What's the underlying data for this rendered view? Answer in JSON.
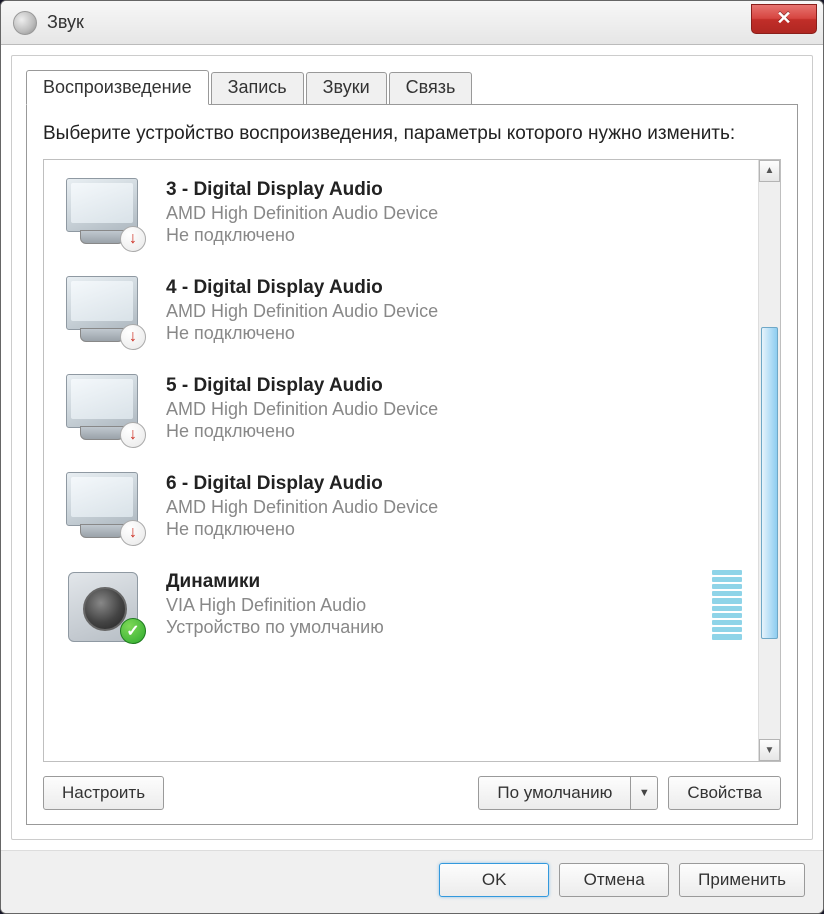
{
  "window": {
    "title": "Звук"
  },
  "tabs": [
    {
      "label": "Воспроизведение",
      "active": true
    },
    {
      "label": "Запись",
      "active": false
    },
    {
      "label": "Звуки",
      "active": false
    },
    {
      "label": "Связь",
      "active": false
    }
  ],
  "instruction": "Выберите устройство воспроизведения, параметры которого нужно изменить:",
  "devices": [
    {
      "name": "3 - Digital Display Audio",
      "description": "AMD High Definition Audio Device",
      "status": "Не подключено",
      "icon": "monitor",
      "badge": "disconnected"
    },
    {
      "name": "4 - Digital Display Audio",
      "description": "AMD High Definition Audio Device",
      "status": "Не подключено",
      "icon": "monitor",
      "badge": "disconnected"
    },
    {
      "name": "5 - Digital Display Audio",
      "description": "AMD High Definition Audio Device",
      "status": "Не подключено",
      "icon": "monitor",
      "badge": "disconnected"
    },
    {
      "name": "6 - Digital Display Audio",
      "description": "AMD High Definition Audio Device",
      "status": "Не подключено",
      "icon": "monitor",
      "badge": "disconnected"
    },
    {
      "name": "Динамики",
      "description": "VIA High Definition Audio",
      "status": "Устройство по умолчанию",
      "icon": "speaker",
      "badge": "default",
      "show_level": true
    }
  ],
  "buttons": {
    "configure": "Настроить",
    "set_default": "По умолчанию",
    "properties": "Свойства",
    "ok": "OK",
    "cancel": "Отмена",
    "apply": "Применить"
  }
}
